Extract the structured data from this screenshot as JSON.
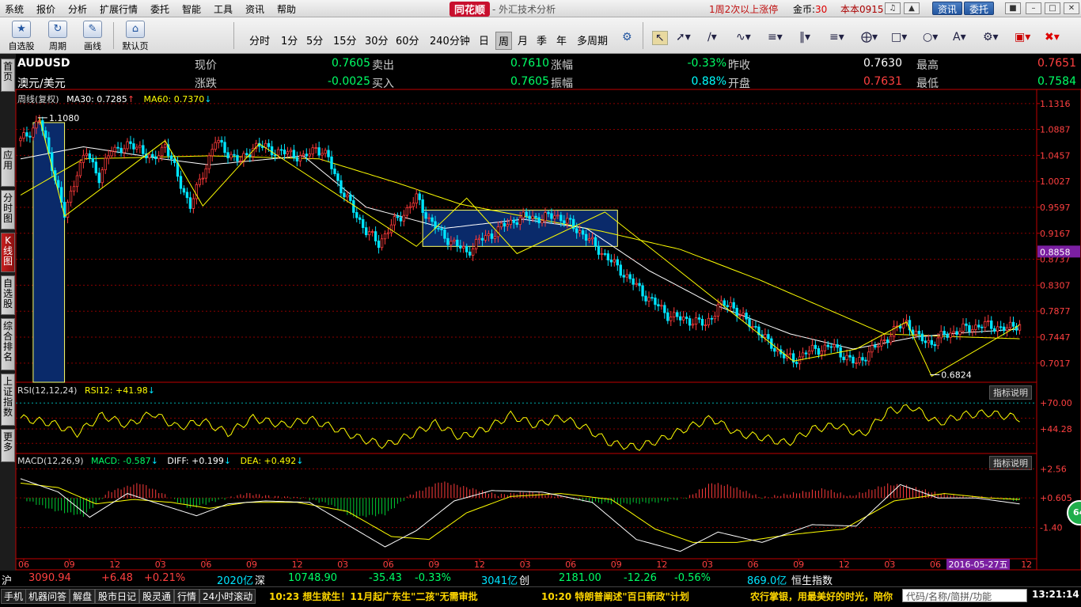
{
  "menu": {
    "items": [
      "系统",
      "报价",
      "分析",
      "扩展行情",
      "委托",
      "智能",
      "工具",
      "资讯",
      "帮助"
    ],
    "brand": "同花顺",
    "app_title": "- 外汇技术分析",
    "promo": "1周2次以上涨停",
    "coin_label": "金币:",
    "coin_value": "30",
    "version": "本本0915",
    "btn_news": "资讯",
    "btn_trade": "委托"
  },
  "toolbar": {
    "big_buttons": [
      {
        "icon": "star-icon",
        "label": "自选股"
      },
      {
        "icon": "cycle-icon",
        "label": "周期"
      },
      {
        "icon": "pencil-icon",
        "label": "画线"
      },
      {
        "icon": "home-icon",
        "label": "默认页"
      }
    ],
    "periods": [
      "分时",
      "1分",
      "5分",
      "15分",
      "30分",
      "60分",
      "240分钟",
      "日",
      "周",
      "月",
      "季",
      "年",
      "多周期"
    ],
    "active_period": "周"
  },
  "left_tabs": [
    "首页",
    "应用",
    "分时图",
    "K线图",
    "自选股",
    "综合排名",
    "上证指数",
    "更多"
  ],
  "active_left_tab": "K线图",
  "quote": {
    "symbol": "AUDUSD",
    "name": "澳元/美元",
    "rows": [
      [
        {
          "label": "现价",
          "value": "0.7605",
          "color": "#00ff66"
        },
        {
          "label": "卖出",
          "value": "0.7610",
          "color": "#00ff66"
        },
        {
          "label": "涨幅",
          "value": "-0.33%",
          "color": "#00ff66"
        },
        {
          "label": "昨收",
          "value": "0.7630",
          "color": "#ffffff"
        },
        {
          "label": "最高",
          "value": "0.7651",
          "color": "#ff4040"
        }
      ],
      [
        {
          "label": "涨跌",
          "value": "-0.0025",
          "color": "#00ff66"
        },
        {
          "label": "买入",
          "value": "0.7605",
          "color": "#00ff66"
        },
        {
          "label": "振幅",
          "value": "0.88%",
          "color": "#00ffff"
        },
        {
          "label": "开盘",
          "value": "0.7631",
          "color": "#ff4040"
        },
        {
          "label": "最低",
          "value": "0.7584",
          "color": "#00ff66"
        }
      ]
    ]
  },
  "main_title": {
    "period": "周线(复权)",
    "ma30": "MA30: 0.7285",
    "ma60": "MA60: 0.7370"
  },
  "rsi_title": {
    "label": "RSI(12,12,24)",
    "value": "RSI12: +41.98"
  },
  "macd_title": {
    "label": "MACD(12,26,9)",
    "macd": "MACD: -0.587",
    "diff": "DIFF: +0.199",
    "dea": "DEA: +0.492"
  },
  "explain_label": "指标说明",
  "colors": {
    "up": "#ff3b3b",
    "down": "#00e5ff",
    "ma_white": "#ffffff",
    "ma_yellow": "#ffff00",
    "grid": "#8b0000",
    "axis": "#c00000",
    "box": "#0a2a6a",
    "box_border": "#ffff66"
  },
  "chart_data": [
    {
      "type": "candlestick",
      "title": "AUDUSD",
      "y_ticks": [
        "1.1316",
        "1.0887",
        "1.0457",
        "1.0027",
        "0.9597",
        "0.9167",
        "0.8737",
        "0.8307",
        "0.7877",
        "0.7447",
        "0.7017"
      ],
      "ylim": [
        0.67,
        1.134
      ],
      "current_price_label": "0.8858",
      "annotations": [
        {
          "text": "1.1080",
          "value": 1.108
        },
        {
          "text": "0.6824",
          "value": 0.6824
        }
      ],
      "x_ticks": [
        "06",
        "09",
        "12",
        "03",
        "06",
        "09",
        "12",
        "03",
        "06",
        "09",
        "12",
        "03",
        "06",
        "09",
        "12",
        "03",
        "06",
        "09",
        "12",
        "03",
        "06",
        "09",
        "12",
        "03"
      ],
      "date_label": "2016-05-27五",
      "anchors": [
        [
          0,
          1.07
        ],
        [
          3,
          1.085
        ],
        [
          6,
          1.105
        ],
        [
          10,
          1.03
        ],
        [
          14,
          0.945
        ],
        [
          18,
          1.02
        ],
        [
          21,
          1.05
        ],
        [
          25,
          1.01
        ],
        [
          29,
          1.055
        ],
        [
          33,
          1.06
        ],
        [
          38,
          1.06
        ],
        [
          42,
          1.035
        ],
        [
          46,
          1.065
        ],
        [
          50,
          1.01
        ],
        [
          54,
          0.962
        ],
        [
          58,
          1.015
        ],
        [
          62,
          1.07
        ],
        [
          66,
          1.05
        ],
        [
          70,
          1.035
        ],
        [
          74,
          1.06
        ],
        [
          78,
          1.06
        ],
        [
          82,
          1.05
        ],
        [
          86,
          1.05
        ],
        [
          90,
          1.04
        ],
        [
          94,
          1.06
        ],
        [
          98,
          1.04
        ],
        [
          102,
          0.99
        ],
        [
          106,
          0.955
        ],
        [
          110,
          0.92
        ],
        [
          114,
          0.9
        ],
        [
          118,
          0.93
        ],
        [
          122,
          0.95
        ],
        [
          126,
          0.975
        ],
        [
          130,
          0.94
        ],
        [
          134,
          0.915
        ],
        [
          138,
          0.9
        ],
        [
          142,
          0.885
        ],
        [
          146,
          0.905
        ],
        [
          150,
          0.915
        ],
        [
          154,
          0.93
        ],
        [
          158,
          0.94
        ],
        [
          162,
          0.945
        ],
        [
          166,
          0.94
        ],
        [
          170,
          0.948
        ],
        [
          174,
          0.935
        ],
        [
          178,
          0.92
        ],
        [
          182,
          0.9
        ],
        [
          186,
          0.88
        ],
        [
          190,
          0.86
        ],
        [
          194,
          0.84
        ],
        [
          198,
          0.818
        ],
        [
          202,
          0.8
        ],
        [
          206,
          0.782
        ],
        [
          210,
          0.775
        ],
        [
          214,
          0.772
        ],
        [
          218,
          0.765
        ],
        [
          222,
          0.795
        ],
        [
          226,
          0.8
        ],
        [
          230,
          0.775
        ],
        [
          234,
          0.76
        ],
        [
          238,
          0.735
        ],
        [
          242,
          0.718
        ],
        [
          246,
          0.705
        ],
        [
          250,
          0.72
        ],
        [
          254,
          0.725
        ],
        [
          258,
          0.73
        ],
        [
          262,
          0.715
        ],
        [
          266,
          0.7
        ],
        [
          270,
          0.72
        ],
        [
          274,
          0.735
        ],
        [
          278,
          0.755
        ],
        [
          282,
          0.77
        ],
        [
          286,
          0.742
        ],
        [
          290,
          0.735
        ],
        [
          294,
          0.748
        ],
        [
          298,
          0.755
        ],
        [
          302,
          0.76
        ],
        [
          306,
          0.765
        ],
        [
          310,
          0.762
        ],
        [
          314,
          0.758
        ],
        [
          318,
          0.768
        ]
      ],
      "ma_white_anchors": [
        [
          0,
          1.04
        ],
        [
          20,
          1.06
        ],
        [
          45,
          1.04
        ],
        [
          60,
          1.03
        ],
        [
          90,
          1.045
        ],
        [
          110,
          0.96
        ],
        [
          135,
          0.925
        ],
        [
          160,
          0.94
        ],
        [
          180,
          0.925
        ],
        [
          200,
          0.855
        ],
        [
          220,
          0.8
        ],
        [
          245,
          0.75
        ],
        [
          265,
          0.725
        ],
        [
          285,
          0.745
        ],
        [
          300,
          0.752
        ],
        [
          318,
          0.758
        ]
      ],
      "ma_yellow_anchors": [
        [
          0,
          0.98
        ],
        [
          20,
          1.04
        ],
        [
          60,
          1.045
        ],
        [
          95,
          1.04
        ],
        [
          120,
          1.0
        ],
        [
          140,
          0.965
        ],
        [
          165,
          0.94
        ],
        [
          185,
          0.92
        ],
        [
          210,
          0.89
        ],
        [
          235,
          0.84
        ],
        [
          255,
          0.795
        ],
        [
          275,
          0.75
        ],
        [
          300,
          0.745
        ],
        [
          318,
          0.742
        ]
      ],
      "boxes": [
        {
          "from": 4,
          "to": 14,
          "top": 1.1,
          "bottom": 0.67
        },
        {
          "from": 128,
          "to": 190,
          "top": 0.955,
          "bottom": 0.895
        }
      ],
      "zigzag": [
        [
          6,
          1.108
        ],
        [
          14,
          0.945
        ],
        [
          46,
          1.07
        ],
        [
          58,
          0.962
        ],
        [
          76,
          1.065
        ],
        [
          126,
          0.895
        ],
        [
          142,
          0.975
        ],
        [
          158,
          0.883
        ],
        [
          186,
          0.952
        ],
        [
          246,
          0.705
        ],
        [
          266,
          0.725
        ],
        [
          282,
          0.77
        ],
        [
          290,
          0.68
        ],
        [
          318,
          0.765
        ]
      ]
    },
    {
      "type": "line",
      "title": "RSI(12,12,24)",
      "y_ticks": [
        "+70.00",
        "+44.28"
      ],
      "ylim": [
        20,
        78
      ],
      "series": [
        {
          "name": "RSI12",
          "anchors": [
            [
              0,
              55
            ],
            [
              10,
              50
            ],
            [
              18,
              40
            ],
            [
              26,
              58
            ],
            [
              34,
              48
            ],
            [
              42,
              60
            ],
            [
              50,
              46
            ],
            [
              58,
              52
            ],
            [
              66,
              40
            ],
            [
              74,
              55
            ],
            [
              84,
              48
            ],
            [
              92,
              54
            ],
            [
              100,
              45
            ],
            [
              108,
              35
            ],
            [
              116,
              28
            ],
            [
              124,
              38
            ],
            [
              132,
              50
            ],
            [
              140,
              36
            ],
            [
              148,
              44
            ],
            [
              156,
              58
            ],
            [
              164,
              48
            ],
            [
              172,
              56
            ],
            [
              180,
              45
            ],
            [
              188,
              30
            ],
            [
              196,
              26
            ],
            [
              204,
              34
            ],
            [
              212,
              45
            ],
            [
              220,
              55
            ],
            [
              228,
              40
            ],
            [
              236,
              36
            ],
            [
              244,
              30
            ],
            [
              252,
              44
            ],
            [
              260,
              48
            ],
            [
              268,
              38
            ],
            [
              276,
              62
            ],
            [
              284,
              66
            ],
            [
              292,
              50
            ],
            [
              300,
              58
            ],
            [
              308,
              60
            ],
            [
              318,
              55
            ]
          ]
        }
      ]
    },
    {
      "type": "bar",
      "title": "MACD(12,26,9)",
      "y_ticks": [
        "+2.56",
        "+0.605",
        "-1.40"
      ],
      "ylim": [
        -3.5,
        2.8
      ],
      "histogram_anchors": [
        [
          0,
          0.0
        ],
        [
          10,
          -0.8
        ],
        [
          20,
          -1.2
        ],
        [
          28,
          0.4
        ],
        [
          38,
          1.0
        ],
        [
          46,
          0.2
        ],
        [
          54,
          -0.7
        ],
        [
          62,
          -0.2
        ],
        [
          72,
          0.3
        ],
        [
          80,
          0.1
        ],
        [
          90,
          0.0
        ],
        [
          98,
          -0.4
        ],
        [
          106,
          -1.3
        ],
        [
          116,
          -1.1
        ],
        [
          124,
          0.2
        ],
        [
          134,
          1.1
        ],
        [
          144,
          0.6
        ],
        [
          152,
          0.2
        ],
        [
          162,
          0.4
        ],
        [
          172,
          0.1
        ],
        [
          182,
          -0.3
        ],
        [
          192,
          -0.4
        ],
        [
          202,
          -0.3
        ],
        [
          212,
          0.0
        ],
        [
          220,
          1.0
        ],
        [
          226,
          0.8
        ],
        [
          236,
          0.0
        ],
        [
          246,
          0.3
        ],
        [
          256,
          0.6
        ],
        [
          264,
          0.1
        ],
        [
          276,
          0.9
        ],
        [
          282,
          0.8
        ],
        [
          292,
          0.3
        ],
        [
          300,
          0.1
        ],
        [
          310,
          0.0
        ],
        [
          318,
          -0.2
        ]
      ],
      "series": [
        {
          "name": "DIFF",
          "anchors": [
            [
              0,
              1.9
            ],
            [
              12,
              1.0
            ],
            [
              22,
              -0.7
            ],
            [
              34,
              0.9
            ],
            [
              44,
              0.2
            ],
            [
              56,
              -0.6
            ],
            [
              66,
              0.2
            ],
            [
              78,
              0.4
            ],
            [
              92,
              0.3
            ],
            [
              104,
              -1.2
            ],
            [
              116,
              -2.7
            ],
            [
              126,
              -1.6
            ],
            [
              138,
              0.4
            ],
            [
              150,
              1.1
            ],
            [
              166,
              1.0
            ],
            [
              182,
              0.3
            ],
            [
              196,
              -2.2
            ],
            [
              210,
              -3.0
            ],
            [
              222,
              -1.7
            ],
            [
              236,
              -2.4
            ],
            [
              252,
              -1.2
            ],
            [
              266,
              -1.3
            ],
            [
              280,
              1.5
            ],
            [
              292,
              0.6
            ],
            [
              304,
              0.6
            ],
            [
              318,
              0.2
            ]
          ]
        },
        {
          "name": "DEA",
          "anchors": [
            [
              0,
              1.6
            ],
            [
              12,
              1.3
            ],
            [
              24,
              0.2
            ],
            [
              36,
              0.5
            ],
            [
              48,
              0.3
            ],
            [
              60,
              -0.1
            ],
            [
              72,
              0.3
            ],
            [
              88,
              0.3
            ],
            [
              104,
              -0.3
            ],
            [
              118,
              -2.0
            ],
            [
              130,
              -2.2
            ],
            [
              142,
              -0.4
            ],
            [
              156,
              0.7
            ],
            [
              172,
              0.9
            ],
            [
              188,
              0.5
            ],
            [
              202,
              -1.5
            ],
            [
              214,
              -2.4
            ],
            [
              228,
              -2.4
            ],
            [
              244,
              -1.9
            ],
            [
              262,
              -1.5
            ],
            [
              278,
              0.4
            ],
            [
              294,
              0.9
            ],
            [
              308,
              0.6
            ],
            [
              318,
              0.5
            ]
          ]
        }
      ]
    }
  ],
  "index_bar": {
    "sh_label": "沪",
    "sh_value": "3090.94",
    "sh_change": "+6.48",
    "sh_pct": "+0.21%",
    "sh_amount": "2020亿",
    "sz_label": "深",
    "sz_value": "10748.90",
    "sz_change": "-35.43",
    "sz_pct": "-0.33%",
    "sz_amount": "3041亿",
    "cy_label": "创",
    "cy_value": "2181.00",
    "cy_change": "-12.26",
    "cy_pct": "-0.56%",
    "cy_amount": "869.0亿",
    "hs_label": "恒生指数"
  },
  "status_bar": {
    "buttons": [
      "手机",
      "机器问答",
      "解盘",
      "股市日记",
      "股灵通",
      "行情",
      "24小时滚动"
    ],
    "news1": "10:23 想生就生！11月起广东生\"二孩\"无需审批",
    "news2": "10:20 特朗普阐述\"百日新政\"计划",
    "news3": "农行掌银，用最美好的时光，陪你",
    "search_placeholder": "代码/名称/简拼/功能",
    "clock": "13:21:14",
    "badge": "64"
  }
}
